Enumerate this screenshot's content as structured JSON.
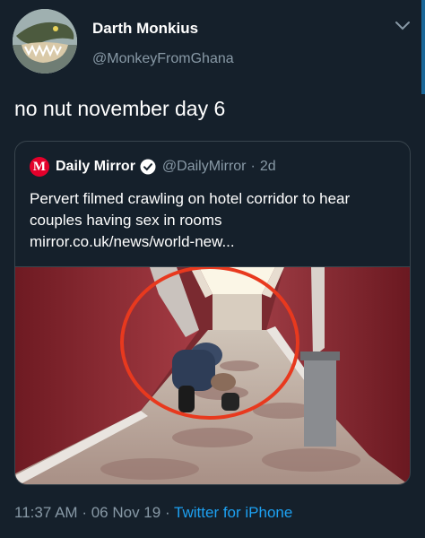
{
  "tweet": {
    "display_name": "Darth Monkius",
    "handle": "@MonkeyFromGhana",
    "text": "no nut november day 6"
  },
  "quote": {
    "source_name": "Daily Mirror",
    "handle": "@DailyMirror",
    "separator": "·",
    "time": "2d",
    "text": "Pervert filmed crawling on hotel corridor to hear couples having sex in rooms",
    "link": "mirror.co.uk/news/world-new...",
    "logo_letter": "M"
  },
  "footer": {
    "time": "11:37 AM",
    "sep1": "·",
    "date": "06 Nov 19",
    "sep2": "·",
    "source": "Twitter for iPhone"
  },
  "colors": {
    "background": "#15202b",
    "secondary_text": "#8899a6",
    "accent": "#1da1f2",
    "mirror_red": "#e4002b",
    "circle_red": "#e8391e"
  },
  "icons": {
    "caret": "chevron-down-icon",
    "verified": "verified-badge-icon"
  }
}
